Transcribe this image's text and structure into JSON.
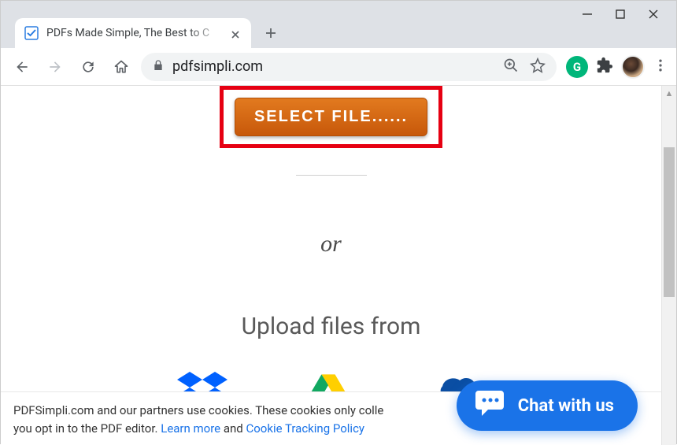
{
  "window": {
    "tab_title": "PDFs Made Simple, The Best to C"
  },
  "toolbar": {
    "url": "pdfsimpli.com"
  },
  "page": {
    "select_button": "SELECT FILE......",
    "or": "or",
    "upload_heading": "Upload files from"
  },
  "cookie": {
    "line1_prefix": "PDFSimpli.com and our partners use cookies. These cookies only colle",
    "line2_prefix": "you opt in to the PDF editor. ",
    "learn_more": "Learn more",
    "and": " and ",
    "policy": "Cookie Tracking Policy"
  },
  "chat": {
    "label": "Chat with us"
  }
}
